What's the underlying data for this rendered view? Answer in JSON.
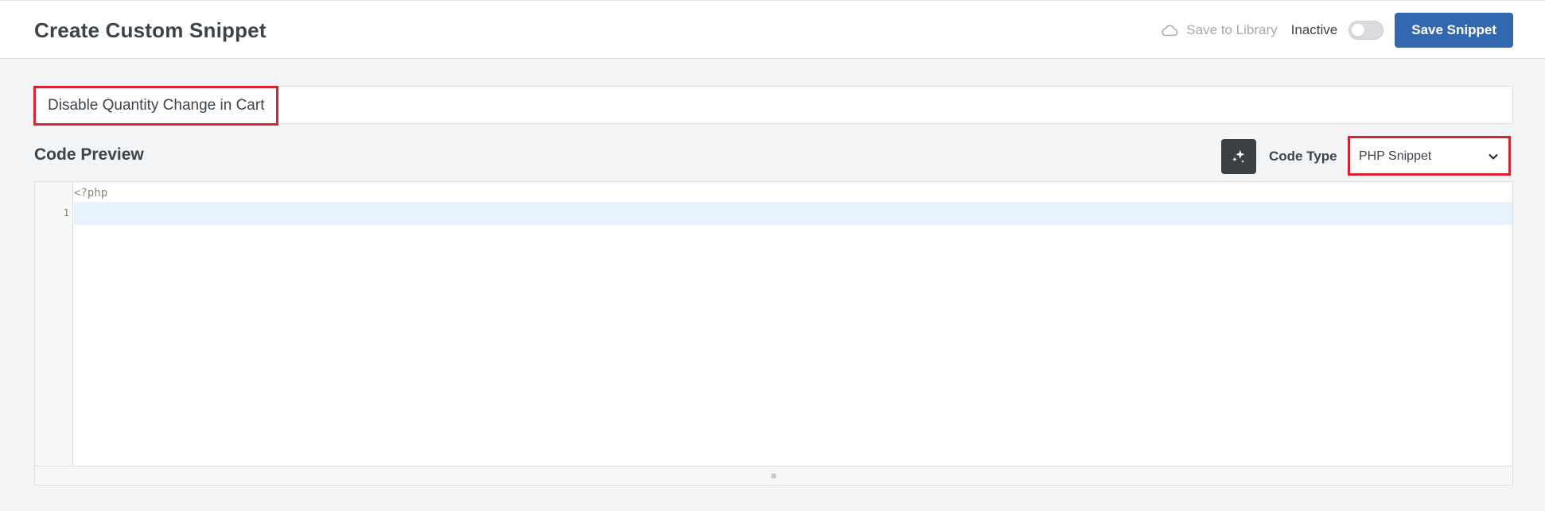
{
  "header": {
    "title": "Create Custom Snippet",
    "save_to_library": "Save to Library",
    "status_label": "Inactive",
    "status_active": false,
    "save_button": "Save Snippet"
  },
  "snippet": {
    "title_value": "Disable Quantity Change in Cart"
  },
  "code_preview": {
    "section_title": "Code Preview",
    "ai_button_icon": "sparkles-icon",
    "code_type_label": "Code Type",
    "code_type_selected": "PHP Snippet",
    "editor": {
      "prefix": "<?php",
      "line_numbers": [
        "1"
      ],
      "code_lines": [
        ""
      ]
    },
    "resize_handle": "≡"
  },
  "colors": {
    "primary_button": "#3368b1",
    "highlight": "#d9232e",
    "active_line": "#e8f2fe"
  }
}
